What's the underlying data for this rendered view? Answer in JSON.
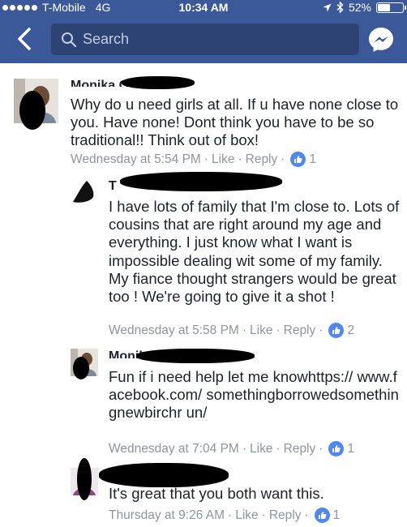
{
  "status_bar": {
    "carrier": "T-Mobile",
    "network": "4G",
    "time": "10:34 AM",
    "battery": "52%",
    "battery_level": 0.52,
    "icons": [
      "location-arrow-icon",
      "bluetooth-icon",
      "battery-icon"
    ]
  },
  "header": {
    "search_placeholder": "Search",
    "icons": [
      "back-arrow-icon",
      "search-icon",
      "messenger-icon"
    ]
  },
  "comments": [
    {
      "name": "Monika Cassidy",
      "text": "Why do u need girls at all.  If u have none close to you.  Have none!  Dont think you have to be so traditional!!  Think out of box!",
      "time": "Wednesday at 5:54 PM",
      "like_label": "Like",
      "reply_label": "Reply",
      "likes": "1"
    },
    {
      "name": "T",
      "text": "I have lots of family that I'm close to. Lots of cousins that are right around my age and everything. I just know what I want is impossible dealing wit some of my family. My fiance thought strangers would be great too ! We're going to give it a shot !",
      "time": "Wednesday at 5:58 PM",
      "like_label": "Like",
      "reply_label": "Reply",
      "likes": "2"
    },
    {
      "name": "Monika Cassidy",
      "text": "Fun if i need help let me knowhttps:// www.facebook.com/ somethingborrowedsomethingnewbirchr un/",
      "time": "Wednesday at 7:04 PM",
      "like_label": "Like",
      "reply_label": "Reply",
      "likes": "1"
    },
    {
      "name": "",
      "text": "It's great that you both want this.",
      "time": "Thursday at 9:26 AM",
      "like_label": "Like",
      "reply_label": "Reply",
      "likes": "1"
    }
  ],
  "colors": {
    "header_bg": "#3b5998",
    "search_bg": "#2d4373",
    "meta_text": "#90949c",
    "like_badge": "#4f87f5"
  }
}
